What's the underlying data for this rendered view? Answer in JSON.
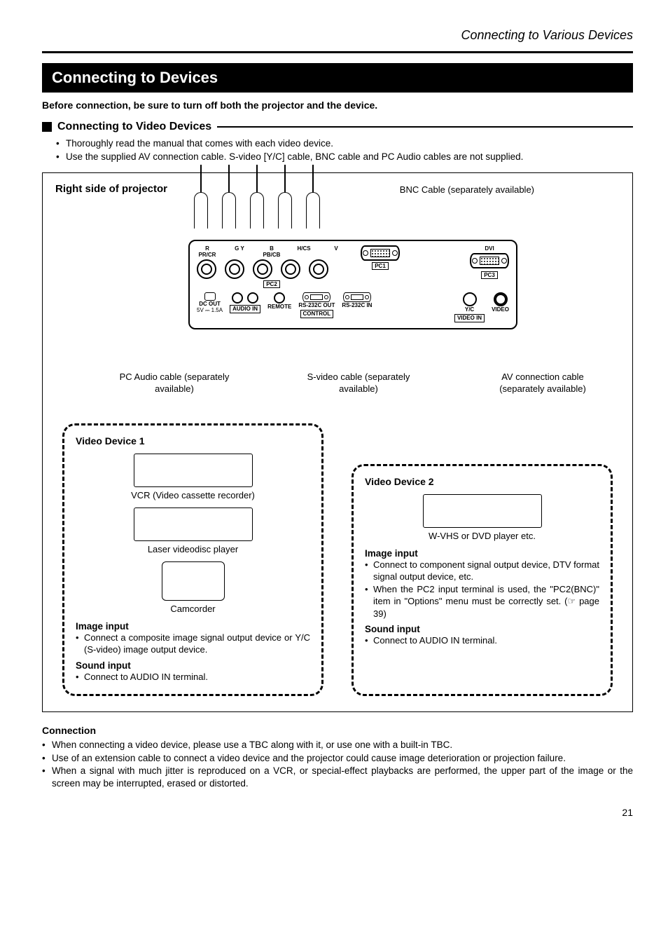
{
  "header": {
    "breadcrumb": "Connecting to Various Devices"
  },
  "section": {
    "title": "Connecting to Devices",
    "warning": "Before connection, be sure to turn off both the projector and the device.",
    "sub_title": "Connecting to Video Devices",
    "sub_bullets": [
      "Thoroughly read the manual that comes with each video device.",
      "Use the supplied AV connection cable. S-video [Y/C] cable, BNC cable and PC Audio cables are not supplied."
    ]
  },
  "diagram": {
    "projector_side_label": "Right side of projector",
    "bnc_cable_note": "BNC Cable (separately available)",
    "ports": {
      "bnc": [
        "R PR/CR",
        "G Y",
        "B PB/CB",
        "H/CS",
        "V"
      ],
      "pc1": "PC1",
      "pc2": "PC2",
      "pc3": "PC3",
      "dvi": "DVI",
      "dc_out": "DC OUT",
      "dc_out_spec": "5V ⎓ 1.5A",
      "audio_in": "AUDIO IN",
      "remote": "REMOTE",
      "rs232_out": "RS-232C OUT",
      "rs232_in": "RS-232C IN",
      "control": "CONTROL",
      "yc": "Y/C",
      "video": "VIDEO",
      "video_in": "VIDEO IN"
    },
    "cables": {
      "pc_audio": "PC Audio cable (separately available)",
      "s_video": "S-video cable (separately available)",
      "av": "AV connection cable (separately available)"
    },
    "device1": {
      "title": "Video Device 1",
      "items": [
        "VCR (Video cassette recorder)",
        "Laser videodisc player",
        "Camcorder"
      ],
      "image_input_heading": "Image input",
      "image_input": "Connect a composite image signal output device or Y/C (S-video) image output device.",
      "sound_input_heading": "Sound input",
      "sound_input": "Connect to AUDIO IN terminal."
    },
    "device2": {
      "title": "Video Device 2",
      "item": "W-VHS or DVD player etc.",
      "image_input_heading": "Image input",
      "image_input_1": "Connect to component signal output device, DTV format signal output device, etc.",
      "image_input_2": "When the PC2 input terminal is used, the \"PC2(BNC)\" item in \"Options\" menu must be correctly set. (☞ page 39)",
      "sound_input_heading": "Sound input",
      "sound_input": "Connect to AUDIO IN terminal."
    }
  },
  "connection": {
    "heading": "Connection",
    "bullets": [
      "When connecting a video device, please use a TBC along with it, or use one with a built-in TBC.",
      "Use of an extension cable to connect a video device and the projector could cause image deterioration or projection failure.",
      "When a signal with much jitter is reproduced on a VCR, or special-effect playbacks are performed, the upper part of the image or the screen may be interrupted, erased or distorted."
    ]
  },
  "page_number": "21"
}
